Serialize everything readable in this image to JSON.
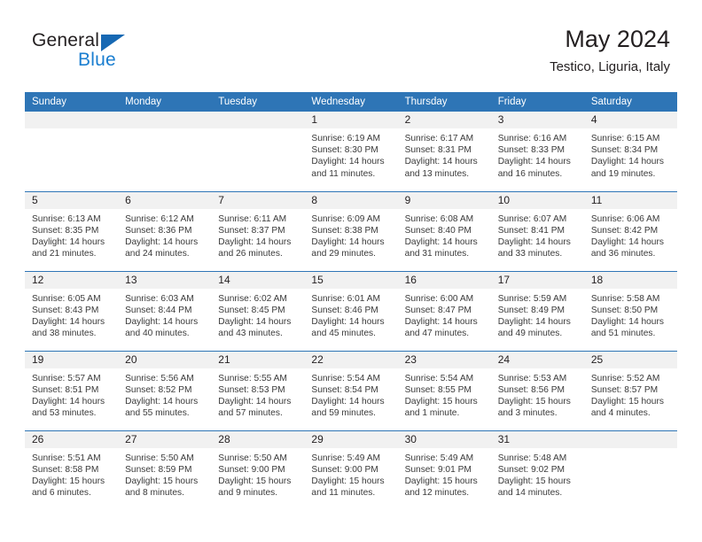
{
  "brand": {
    "line1": "General",
    "line2": "Blue",
    "accent_blue": "#1a7ed0",
    "triangle_blue": "#1668b3"
  },
  "header": {
    "title": "May 2024",
    "subtitle": "Testico, Liguria, Italy"
  },
  "calendar": {
    "header_bg": "#2e75b6",
    "daynum_bg": "#f1f1f1",
    "weekdays": [
      "Sunday",
      "Monday",
      "Tuesday",
      "Wednesday",
      "Thursday",
      "Friday",
      "Saturday"
    ],
    "weeks": [
      [
        {
          "day": "",
          "sunrise": "",
          "sunset": "",
          "daylight": "",
          "empty": true
        },
        {
          "day": "",
          "sunrise": "",
          "sunset": "",
          "daylight": "",
          "empty": true
        },
        {
          "day": "",
          "sunrise": "",
          "sunset": "",
          "daylight": "",
          "empty": true
        },
        {
          "day": "1",
          "sunrise": "Sunrise: 6:19 AM",
          "sunset": "Sunset: 8:30 PM",
          "daylight": "Daylight: 14 hours and 11 minutes."
        },
        {
          "day": "2",
          "sunrise": "Sunrise: 6:17 AM",
          "sunset": "Sunset: 8:31 PM",
          "daylight": "Daylight: 14 hours and 13 minutes."
        },
        {
          "day": "3",
          "sunrise": "Sunrise: 6:16 AM",
          "sunset": "Sunset: 8:33 PM",
          "daylight": "Daylight: 14 hours and 16 minutes."
        },
        {
          "day": "4",
          "sunrise": "Sunrise: 6:15 AM",
          "sunset": "Sunset: 8:34 PM",
          "daylight": "Daylight: 14 hours and 19 minutes."
        }
      ],
      [
        {
          "day": "5",
          "sunrise": "Sunrise: 6:13 AM",
          "sunset": "Sunset: 8:35 PM",
          "daylight": "Daylight: 14 hours and 21 minutes."
        },
        {
          "day": "6",
          "sunrise": "Sunrise: 6:12 AM",
          "sunset": "Sunset: 8:36 PM",
          "daylight": "Daylight: 14 hours and 24 minutes."
        },
        {
          "day": "7",
          "sunrise": "Sunrise: 6:11 AM",
          "sunset": "Sunset: 8:37 PM",
          "daylight": "Daylight: 14 hours and 26 minutes."
        },
        {
          "day": "8",
          "sunrise": "Sunrise: 6:09 AM",
          "sunset": "Sunset: 8:38 PM",
          "daylight": "Daylight: 14 hours and 29 minutes."
        },
        {
          "day": "9",
          "sunrise": "Sunrise: 6:08 AM",
          "sunset": "Sunset: 8:40 PM",
          "daylight": "Daylight: 14 hours and 31 minutes."
        },
        {
          "day": "10",
          "sunrise": "Sunrise: 6:07 AM",
          "sunset": "Sunset: 8:41 PM",
          "daylight": "Daylight: 14 hours and 33 minutes."
        },
        {
          "day": "11",
          "sunrise": "Sunrise: 6:06 AM",
          "sunset": "Sunset: 8:42 PM",
          "daylight": "Daylight: 14 hours and 36 minutes."
        }
      ],
      [
        {
          "day": "12",
          "sunrise": "Sunrise: 6:05 AM",
          "sunset": "Sunset: 8:43 PM",
          "daylight": "Daylight: 14 hours and 38 minutes."
        },
        {
          "day": "13",
          "sunrise": "Sunrise: 6:03 AM",
          "sunset": "Sunset: 8:44 PM",
          "daylight": "Daylight: 14 hours and 40 minutes."
        },
        {
          "day": "14",
          "sunrise": "Sunrise: 6:02 AM",
          "sunset": "Sunset: 8:45 PM",
          "daylight": "Daylight: 14 hours and 43 minutes."
        },
        {
          "day": "15",
          "sunrise": "Sunrise: 6:01 AM",
          "sunset": "Sunset: 8:46 PM",
          "daylight": "Daylight: 14 hours and 45 minutes."
        },
        {
          "day": "16",
          "sunrise": "Sunrise: 6:00 AM",
          "sunset": "Sunset: 8:47 PM",
          "daylight": "Daylight: 14 hours and 47 minutes."
        },
        {
          "day": "17",
          "sunrise": "Sunrise: 5:59 AM",
          "sunset": "Sunset: 8:49 PM",
          "daylight": "Daylight: 14 hours and 49 minutes."
        },
        {
          "day": "18",
          "sunrise": "Sunrise: 5:58 AM",
          "sunset": "Sunset: 8:50 PM",
          "daylight": "Daylight: 14 hours and 51 minutes."
        }
      ],
      [
        {
          "day": "19",
          "sunrise": "Sunrise: 5:57 AM",
          "sunset": "Sunset: 8:51 PM",
          "daylight": "Daylight: 14 hours and 53 minutes."
        },
        {
          "day": "20",
          "sunrise": "Sunrise: 5:56 AM",
          "sunset": "Sunset: 8:52 PM",
          "daylight": "Daylight: 14 hours and 55 minutes."
        },
        {
          "day": "21",
          "sunrise": "Sunrise: 5:55 AM",
          "sunset": "Sunset: 8:53 PM",
          "daylight": "Daylight: 14 hours and 57 minutes."
        },
        {
          "day": "22",
          "sunrise": "Sunrise: 5:54 AM",
          "sunset": "Sunset: 8:54 PM",
          "daylight": "Daylight: 14 hours and 59 minutes."
        },
        {
          "day": "23",
          "sunrise": "Sunrise: 5:54 AM",
          "sunset": "Sunset: 8:55 PM",
          "daylight": "Daylight: 15 hours and 1 minute."
        },
        {
          "day": "24",
          "sunrise": "Sunrise: 5:53 AM",
          "sunset": "Sunset: 8:56 PM",
          "daylight": "Daylight: 15 hours and 3 minutes."
        },
        {
          "day": "25",
          "sunrise": "Sunrise: 5:52 AM",
          "sunset": "Sunset: 8:57 PM",
          "daylight": "Daylight: 15 hours and 4 minutes."
        }
      ],
      [
        {
          "day": "26",
          "sunrise": "Sunrise: 5:51 AM",
          "sunset": "Sunset: 8:58 PM",
          "daylight": "Daylight: 15 hours and 6 minutes."
        },
        {
          "day": "27",
          "sunrise": "Sunrise: 5:50 AM",
          "sunset": "Sunset: 8:59 PM",
          "daylight": "Daylight: 15 hours and 8 minutes."
        },
        {
          "day": "28",
          "sunrise": "Sunrise: 5:50 AM",
          "sunset": "Sunset: 9:00 PM",
          "daylight": "Daylight: 15 hours and 9 minutes."
        },
        {
          "day": "29",
          "sunrise": "Sunrise: 5:49 AM",
          "sunset": "Sunset: 9:00 PM",
          "daylight": "Daylight: 15 hours and 11 minutes."
        },
        {
          "day": "30",
          "sunrise": "Sunrise: 5:49 AM",
          "sunset": "Sunset: 9:01 PM",
          "daylight": "Daylight: 15 hours and 12 minutes."
        },
        {
          "day": "31",
          "sunrise": "Sunrise: 5:48 AM",
          "sunset": "Sunset: 9:02 PM",
          "daylight": "Daylight: 15 hours and 14 minutes."
        },
        {
          "day": "",
          "sunrise": "",
          "sunset": "",
          "daylight": "",
          "empty": true
        }
      ]
    ]
  }
}
